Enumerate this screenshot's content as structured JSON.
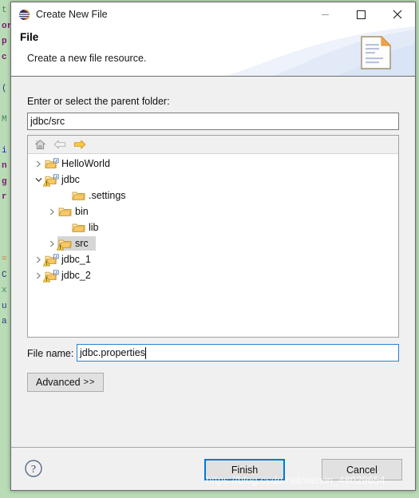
{
  "window": {
    "title": "Create New File",
    "app_icon": "eclipse-icon",
    "controls": {
      "minimize": "minimize-icon",
      "maximize": "maximize-icon",
      "close": "close-icon"
    }
  },
  "header": {
    "title": "File",
    "description": "Create a new file resource.",
    "icon": "new-file-banner-icon"
  },
  "form": {
    "parent_folder_label": "Enter or select the parent folder:",
    "parent_folder_value": "jdbc/src",
    "parent_folder_placeholder": "",
    "file_name_label": "File name:",
    "file_name_value": "jdbc.properties",
    "file_name_placeholder": "",
    "advanced_label": "Advanced",
    "advanced_chevron": ">>"
  },
  "tree_toolbar": {
    "home": "home-icon",
    "back": "back-arrow-icon",
    "forward": "forward-arrow-icon"
  },
  "tree": {
    "items": [
      {
        "label": "HelloWorld",
        "depth": 0,
        "twisty": "collapsed",
        "icon": "java-project-icon",
        "warning": false,
        "selected": false
      },
      {
        "label": "jdbc",
        "depth": 0,
        "twisty": "expanded",
        "icon": "java-project-icon",
        "warning": true,
        "selected": false
      },
      {
        "label": ".settings",
        "depth": 2,
        "twisty": "none",
        "icon": "folder-icon",
        "warning": false,
        "selected": false
      },
      {
        "label": "bin",
        "depth": 1,
        "twisty": "collapsed",
        "icon": "folder-icon",
        "warning": false,
        "selected": false
      },
      {
        "label": "lib",
        "depth": 2,
        "twisty": "none",
        "icon": "folder-icon",
        "warning": false,
        "selected": false
      },
      {
        "label": "src",
        "depth": 1,
        "twisty": "collapsed",
        "icon": "folder-icon",
        "warning": true,
        "selected": true
      },
      {
        "label": "jdbc_1",
        "depth": 0,
        "twisty": "collapsed",
        "icon": "java-project-icon",
        "warning": true,
        "selected": false
      },
      {
        "label": "jdbc_2",
        "depth": 0,
        "twisty": "collapsed",
        "icon": "java-project-icon",
        "warning": true,
        "selected": false
      }
    ]
  },
  "footer": {
    "help": "help-icon",
    "finish_label": "Finish",
    "cancel_label": "Cancel"
  },
  "watermark": "https://blog.csdn.net/weixin_48029654",
  "colors": {
    "accent_focus": "#0078D7",
    "dialog_bg": "#F0F0F0",
    "desktop_bg": "#B9DCB6",
    "folder_orange": "#E8A33D",
    "warning_yellow": "#F5C242"
  },
  "background_code": "t\nor\np\nc\n\n(\n\nM\n\ni\nn\ng\nr\n\n\n\n=\nC\nx\nu\na"
}
